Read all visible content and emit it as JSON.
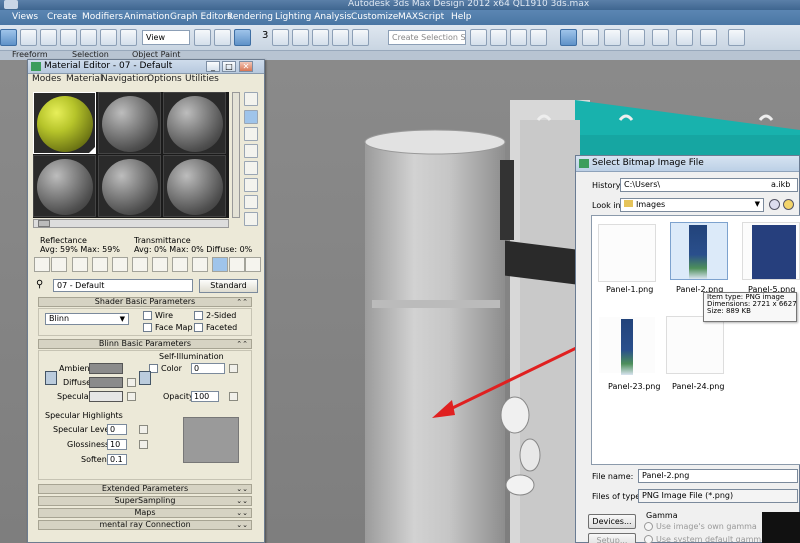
{
  "app": {
    "window_title": "Autodesk 3ds Max Design 2012 x64   QL1910 3ds.max"
  },
  "menu": {
    "items": [
      "Views",
      "Create",
      "Modifiers",
      "Animation",
      "Graph Editors",
      "Rendering",
      "Lighting Analysis",
      "Customize",
      "MAXScript",
      "Help"
    ]
  },
  "toolbar": {
    "view_dropdown": "View",
    "selection_set_placeholder": "Create Selection Se",
    "snap_label": "3",
    "ribbon_labels": [
      "Freeform",
      "Selection",
      "Object Paint"
    ]
  },
  "material_editor": {
    "title": "Material Editor - 07 - Default",
    "menus": [
      "Modes",
      "Material",
      "Navigation",
      "Options",
      "Utilities"
    ],
    "win_buttons": [
      "_",
      "□",
      "✕"
    ],
    "reflectance_label": "Reflectance",
    "reflectance_values": "Avg:  59% Max:  59%",
    "transmittance_label": "Transmittance",
    "transmittance_values": "Avg:   0% Max:   0%  Diffuse:   0%",
    "material_name": "07 - Default",
    "material_type": "Standard",
    "shader_rollout": "Shader Basic Parameters",
    "shader_type": "Blinn",
    "wire_label": "Wire",
    "two_sided_label": "2-Sided",
    "face_map_label": "Face Map",
    "faceted_label": "Faceted",
    "blinn_rollout": "Blinn Basic Parameters",
    "self_illum_label": "Self-Illumination",
    "color_label": "Color",
    "color_value": "0",
    "ambient_label": "Ambient:",
    "diffuse_label": "Diffuse:",
    "specular_label": "Specular:",
    "opacity_label": "Opacity:",
    "opacity_value": "100",
    "spec_highlights_label": "Specular Highlights",
    "spec_level_label": "Specular Level:",
    "spec_level_value": "0",
    "glossiness_label": "Glossiness:",
    "glossiness_value": "10",
    "soften_label": "Soften:",
    "soften_value": "0.1",
    "rollouts": [
      "Extended Parameters",
      "SuperSampling",
      "Maps",
      "mental ray Connection"
    ],
    "rollout_collapse": "⌄⌄",
    "rollout_expand": "⌃⌃"
  },
  "bitmap_dialog": {
    "title": "Select Bitmap Image File",
    "history_label": "History:",
    "history_value": "C:\\Users\\",
    "history_value_tail": "a.ikb",
    "look_in_label": "Look in:",
    "look_in_value": "Images",
    "files": [
      {
        "name": "Panel-1.png"
      },
      {
        "name": "Panel-2.png"
      },
      {
        "name": "Panel-5.png"
      },
      {
        "name": "Panel-23.png"
      },
      {
        "name": "Panel-24.png"
      }
    ],
    "tooltip": {
      "item_type": "Item type: PNG image",
      "dimensions": "Dimensions: 2721 x 6627",
      "size": "Size: 889 KB"
    },
    "file_name_label": "File name:",
    "file_name_value": "Panel-2.png",
    "files_of_type_label": "Files of type:",
    "files_of_type_value": "PNG Image File (*.png)",
    "devices_button": "Devices...",
    "setup_button": "Setup...",
    "gamma_label": "Gamma",
    "gamma_own": "Use image's own gamma",
    "gamma_system": "Use system default gamma"
  },
  "colors": {
    "teal": "#18b2ad",
    "annotation_red": "#e02020",
    "accent_blue": "#4a76a4"
  }
}
